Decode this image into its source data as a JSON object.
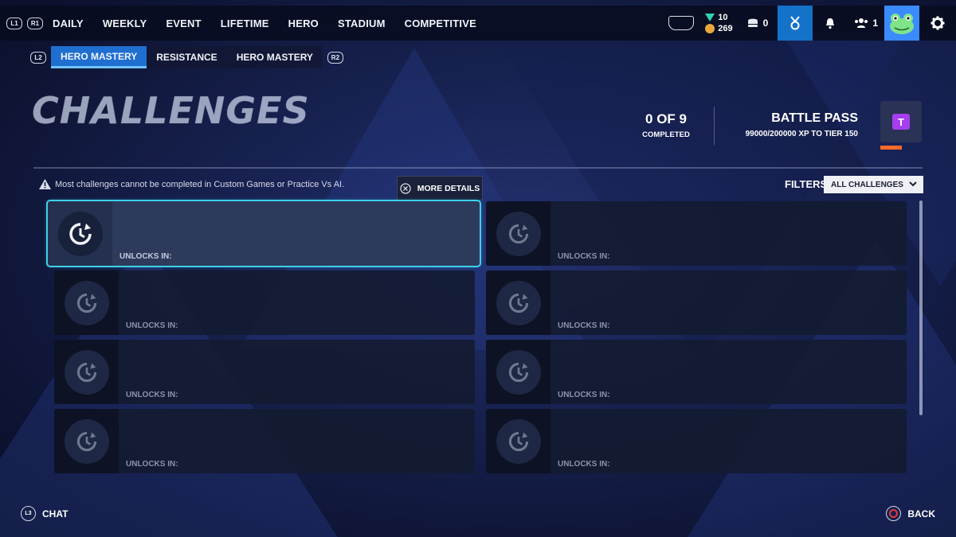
{
  "topbar": {
    "left_bumper": "L1",
    "right_bumper": "R1",
    "nav": [
      "DAILY",
      "WEEKLY",
      "EVENT",
      "LIFETIME",
      "HERO",
      "STADIUM",
      "COMPETITIVE"
    ],
    "legacy_credits": "10",
    "coins": "269",
    "lootboxes": "0",
    "friends_count": "1"
  },
  "subtabs": {
    "left_trigger": "L2",
    "right_trigger": "R2",
    "items": [
      "HERO MASTERY",
      "RESISTANCE",
      "HERO MASTERY"
    ],
    "active_index": 0
  },
  "page": {
    "title": "CHALLENGES",
    "completed_count": "0 OF 9",
    "completed_label": "COMPLETED",
    "battle_pass_title": "BATTLE PASS",
    "battle_pass_xp": "99000/200000 XP TO TIER 150",
    "battle_pass_badge": "T"
  },
  "warning": "Most challenges cannot be completed in Custom Games or Practice Vs AI.",
  "more_details": "MORE DETAILS",
  "filters": {
    "label": "FILTERS",
    "selected": "ALL CHALLENGES"
  },
  "cards": [
    {
      "unlock_label": "UNLOCKS IN:"
    },
    {
      "unlock_label": "UNLOCKS IN:"
    },
    {
      "unlock_label": "UNLOCKS IN:"
    },
    {
      "unlock_label": "UNLOCKS IN:"
    },
    {
      "unlock_label": "UNLOCKS IN:"
    },
    {
      "unlock_label": "UNLOCKS IN:"
    },
    {
      "unlock_label": "UNLOCKS IN:"
    },
    {
      "unlock_label": "UNLOCKS IN:"
    }
  ],
  "footer": {
    "chat_button": "L3",
    "chat": "CHAT",
    "back": "BACK"
  },
  "colors": {
    "accent_blue": "#1f6fd0",
    "selection_cyan": "#3ed0e8",
    "battle_pass_purple": "#a63ef0",
    "progress_orange": "#ff6a2a"
  }
}
